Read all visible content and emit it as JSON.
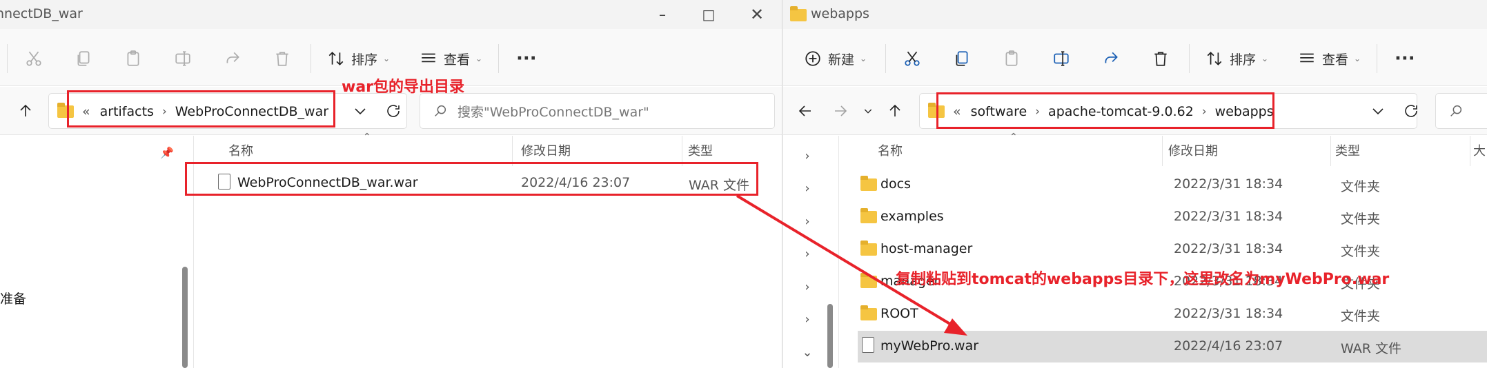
{
  "left_window": {
    "title": "nnectDB_war",
    "toolbar": {
      "sort_label": "排序",
      "view_label": "查看",
      "more_label": "···"
    },
    "address": {
      "prefix": "«",
      "crumbs": [
        "artifacts",
        "WebProConnectDB_war"
      ]
    },
    "search_placeholder": "搜索\"WebProConnectDB_war\"",
    "columns": {
      "name": "名称",
      "modified": "修改日期",
      "type": "类型"
    },
    "nav_pane_text": "准备",
    "files": [
      {
        "name": "WebProConnectDB_war.war",
        "modified": "2022/4/16 23:07",
        "type": "WAR 文件",
        "icon": "file-icon"
      }
    ],
    "annotation": "war包的导出目录"
  },
  "right_window": {
    "title": "webapps",
    "toolbar": {
      "new_label": "新建",
      "sort_label": "排序",
      "view_label": "查看",
      "more_label": "···"
    },
    "address": {
      "prefix": "«",
      "crumbs": [
        "software",
        "apache-tomcat-9.0.62",
        "webapps"
      ]
    },
    "columns": {
      "name": "名称",
      "modified": "修改日期",
      "type": "类型",
      "size": "大"
    },
    "files": [
      {
        "name": "docs",
        "modified": "2022/3/31 18:34",
        "type": "文件夹",
        "icon": "folder-icon"
      },
      {
        "name": "examples",
        "modified": "2022/3/31 18:34",
        "type": "文件夹",
        "icon": "folder-icon"
      },
      {
        "name": "host-manager",
        "modified": "2022/3/31 18:34",
        "type": "文件夹",
        "icon": "folder-icon"
      },
      {
        "name": "manager",
        "modified": "2022/3/31 18:34",
        "type": "文件夹",
        "icon": "folder-icon"
      },
      {
        "name": "ROOT",
        "modified": "2022/3/31 18:34",
        "type": "文件夹",
        "icon": "folder-icon"
      },
      {
        "name": "myWebPro.war",
        "modified": "2022/4/16 23:07",
        "type": "WAR 文件",
        "icon": "file-icon"
      }
    ],
    "annotation": "复制粘贴到tomcat的webapps目录下，这里改名为myWebPro.war"
  },
  "colors": {
    "annotation_red": "#e8222a",
    "selected_row": "#dcdcdc",
    "folder_yellow": "#f5c542"
  }
}
